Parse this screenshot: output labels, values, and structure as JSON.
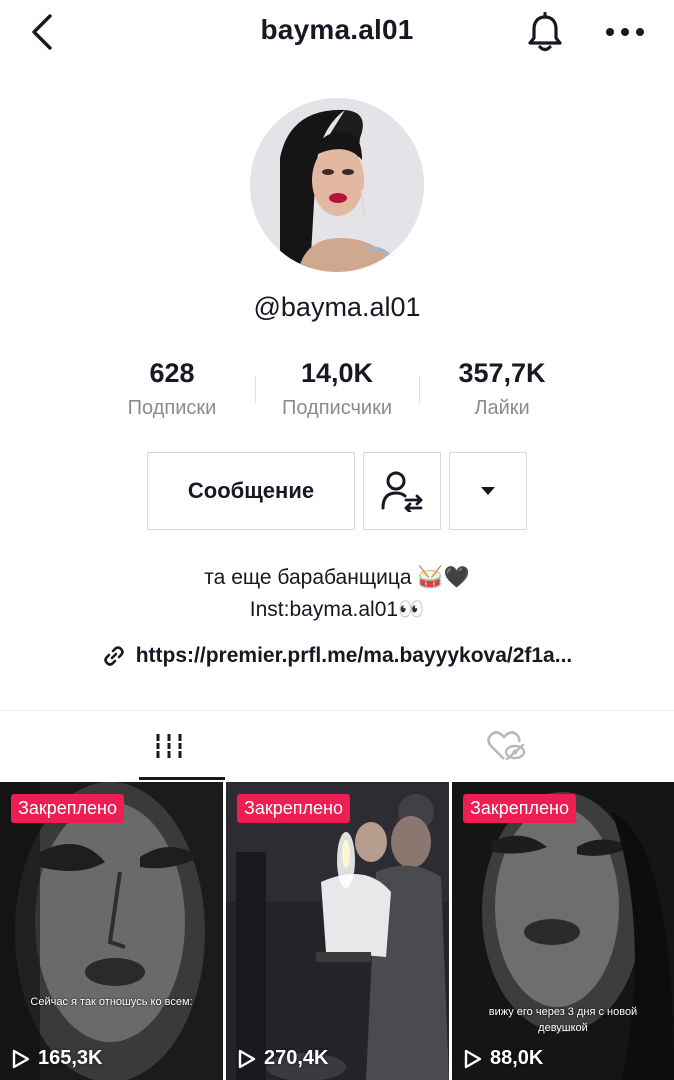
{
  "header": {
    "title": "bayma.al01",
    "back_icon": "chevron-left-icon",
    "bell_icon": "bell-icon",
    "more_icon": "ellipsis-icon"
  },
  "profile": {
    "handle": "@bayma.al01",
    "stats": [
      {
        "value": "628",
        "label": "Подписки"
      },
      {
        "value": "14,0K",
        "label": "Подписчики"
      },
      {
        "value": "357,7K",
        "label": "Лайки"
      }
    ]
  },
  "actions": {
    "message_label": "Сообщение",
    "follow_icon": "user-switch-icon",
    "dropdown_icon": "caret-down-icon"
  },
  "bio": {
    "line1": "та еще барабанщица 🥁🖤",
    "line2": "Inst:bayma.al01👀",
    "link": "https://premier.prfl.me/ma.bayyykova/2f1a..."
  },
  "tabs": {
    "videos_icon": "grid-icon",
    "liked_icon": "liked-hidden-icon"
  },
  "videos": [
    {
      "pin": "Закреплено",
      "caption": "Сейчас я так отношусь ко всем:",
      "views": "165,3K"
    },
    {
      "pin": "Закреплено",
      "caption": "",
      "views": "270,4K"
    },
    {
      "pin": "Закреплено",
      "caption": "вижу его через 3 дня с новой девушкой",
      "views": "88,0K"
    }
  ],
  "colors": {
    "pin_badge": "#ee1d52",
    "text": "#161823",
    "muted": "#8a8b91"
  }
}
